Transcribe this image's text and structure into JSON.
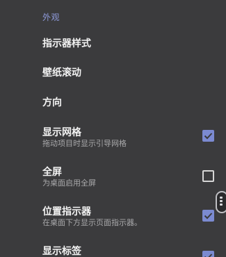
{
  "section": {
    "header": "外观"
  },
  "settings": [
    {
      "title": "指示器样式"
    },
    {
      "title": "壁纸滚动"
    },
    {
      "title": "方向"
    },
    {
      "title": "显示网格",
      "subtitle": "拖动项目时显示引导网格",
      "checked": true
    },
    {
      "title": "全屏",
      "subtitle": "为桌面启用全屏",
      "checked": false
    },
    {
      "title": "位置指示器",
      "subtitle": "在桌面下方显示页面指示器。",
      "checked": true
    },
    {
      "title": "显示标签",
      "checked": true
    }
  ],
  "colors": {
    "background": "#3b3b3d",
    "accent": "#7b8ad1",
    "header": "#8f9bdc"
  },
  "icons": {
    "checkbox_checked": "checkbox-checked-icon",
    "checkbox_unchecked": "checkbox-unchecked-icon",
    "edge_handle": "drag-handle-icon"
  }
}
